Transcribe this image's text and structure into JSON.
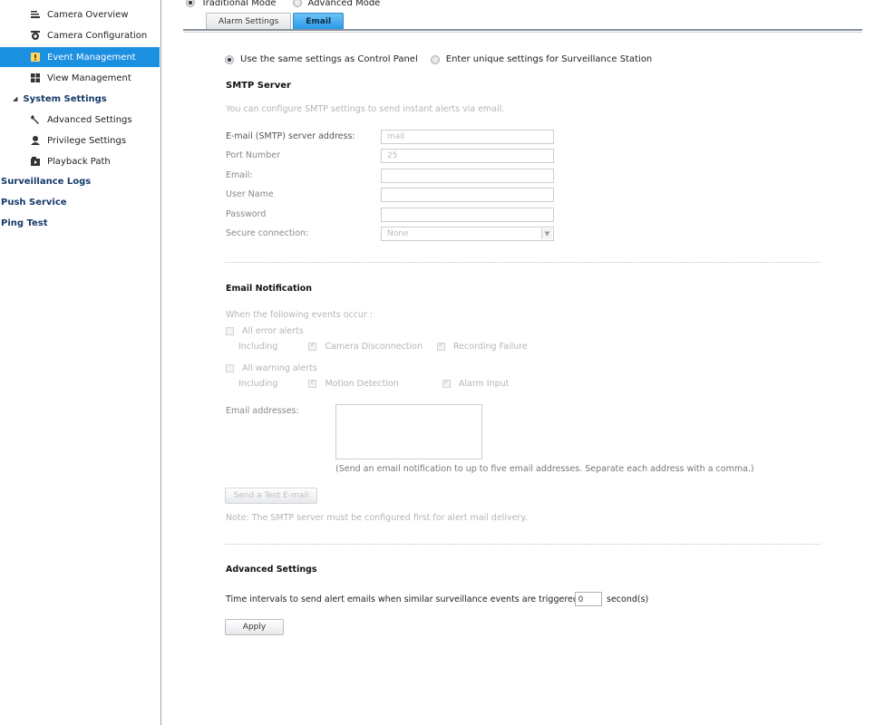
{
  "sidebar": {
    "items": [
      {
        "label": "Camera Overview",
        "icon": "camera-overview-icon"
      },
      {
        "label": "Camera Configuration",
        "icon": "camera-config-icon"
      },
      {
        "label": "Event Management",
        "icon": "event-alert-icon"
      },
      {
        "label": "View Management",
        "icon": "view-grid-icon"
      }
    ],
    "system_settings": {
      "label": "System Settings",
      "children": [
        {
          "label": "Advanced Settings",
          "icon": "wrench-icon"
        },
        {
          "label": "Privilege Settings",
          "icon": "user-icon"
        },
        {
          "label": "Playback Path",
          "icon": "playback-path-icon"
        }
      ]
    },
    "links": [
      "Surveillance Logs",
      "Push Service",
      "Ping Test"
    ],
    "active_color": "#1b8fe0"
  },
  "mode": {
    "traditional": "Traditional Mode",
    "advanced": "Advanced Mode",
    "selected": "Traditional Mode"
  },
  "tabs": [
    "Alarm Settings",
    "Email"
  ],
  "active_tab": "Email",
  "settings_source": {
    "option_same": "Use the same settings as Control Panel",
    "option_unique": "Enter unique settings for Surveillance Station",
    "selected": "Use the same settings as Control Panel"
  },
  "smtp": {
    "heading": "SMTP Server",
    "description": "You can configure SMTP settings to send instant alerts via email.",
    "server_label": "E-mail (SMTP) server address:",
    "server_value": "mail",
    "port_label": "Port Number",
    "port_value": "25",
    "email_label": "Email:",
    "user_label": "User Name",
    "password_label": "Password",
    "secure_label": "Secure connection:",
    "secure_value": "None"
  },
  "notification": {
    "heading": "Email Notification",
    "when_label": "When the following events occur :",
    "error_alerts": "All error alerts",
    "including": "Including",
    "camera_disconnection": "Camera Disconnection",
    "recording_failure": "Recording Failure",
    "warning_alerts": "All warning alerts",
    "motion_detection": "Motion Detection",
    "alarm_input": "Alarm Input",
    "addresses_label": "Email addresses:",
    "addresses_note": "(Send an email notification to up to five email addresses. Separate each address with a comma.)",
    "test_button": "Send a Test E-mail",
    "smtp_note": "Note: The SMTP server must be configured first for alert mail delivery."
  },
  "advanced": {
    "heading": "Advanced Settings",
    "interval_label": "Time intervals to send alert emails when similar surveillance events are triggered:",
    "interval_value": "0",
    "interval_unit": "second(s)",
    "apply": "Apply"
  }
}
